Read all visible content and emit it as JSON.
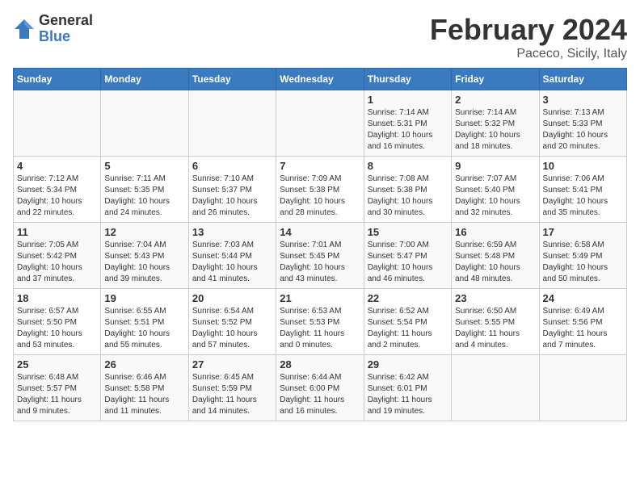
{
  "logo": {
    "general": "General",
    "blue": "Blue"
  },
  "title": "February 2024",
  "subtitle": "Paceco, Sicily, Italy",
  "days_of_week": [
    "Sunday",
    "Monday",
    "Tuesday",
    "Wednesday",
    "Thursday",
    "Friday",
    "Saturday"
  ],
  "weeks": [
    [
      {
        "day": "",
        "info": ""
      },
      {
        "day": "",
        "info": ""
      },
      {
        "day": "",
        "info": ""
      },
      {
        "day": "",
        "info": ""
      },
      {
        "day": "1",
        "info": "Sunrise: 7:14 AM\nSunset: 5:31 PM\nDaylight: 10 hours\nand 16 minutes."
      },
      {
        "day": "2",
        "info": "Sunrise: 7:14 AM\nSunset: 5:32 PM\nDaylight: 10 hours\nand 18 minutes."
      },
      {
        "day": "3",
        "info": "Sunrise: 7:13 AM\nSunset: 5:33 PM\nDaylight: 10 hours\nand 20 minutes."
      }
    ],
    [
      {
        "day": "4",
        "info": "Sunrise: 7:12 AM\nSunset: 5:34 PM\nDaylight: 10 hours\nand 22 minutes."
      },
      {
        "day": "5",
        "info": "Sunrise: 7:11 AM\nSunset: 5:35 PM\nDaylight: 10 hours\nand 24 minutes."
      },
      {
        "day": "6",
        "info": "Sunrise: 7:10 AM\nSunset: 5:37 PM\nDaylight: 10 hours\nand 26 minutes."
      },
      {
        "day": "7",
        "info": "Sunrise: 7:09 AM\nSunset: 5:38 PM\nDaylight: 10 hours\nand 28 minutes."
      },
      {
        "day": "8",
        "info": "Sunrise: 7:08 AM\nSunset: 5:38 PM\nDaylight: 10 hours\nand 30 minutes."
      },
      {
        "day": "9",
        "info": "Sunrise: 7:07 AM\nSunset: 5:40 PM\nDaylight: 10 hours\nand 32 minutes."
      },
      {
        "day": "10",
        "info": "Sunrise: 7:06 AM\nSunset: 5:41 PM\nDaylight: 10 hours\nand 35 minutes."
      }
    ],
    [
      {
        "day": "11",
        "info": "Sunrise: 7:05 AM\nSunset: 5:42 PM\nDaylight: 10 hours\nand 37 minutes."
      },
      {
        "day": "12",
        "info": "Sunrise: 7:04 AM\nSunset: 5:43 PM\nDaylight: 10 hours\nand 39 minutes."
      },
      {
        "day": "13",
        "info": "Sunrise: 7:03 AM\nSunset: 5:44 PM\nDaylight: 10 hours\nand 41 minutes."
      },
      {
        "day": "14",
        "info": "Sunrise: 7:01 AM\nSunset: 5:45 PM\nDaylight: 10 hours\nand 43 minutes."
      },
      {
        "day": "15",
        "info": "Sunrise: 7:00 AM\nSunset: 5:47 PM\nDaylight: 10 hours\nand 46 minutes."
      },
      {
        "day": "16",
        "info": "Sunrise: 6:59 AM\nSunset: 5:48 PM\nDaylight: 10 hours\nand 48 minutes."
      },
      {
        "day": "17",
        "info": "Sunrise: 6:58 AM\nSunset: 5:49 PM\nDaylight: 10 hours\nand 50 minutes."
      }
    ],
    [
      {
        "day": "18",
        "info": "Sunrise: 6:57 AM\nSunset: 5:50 PM\nDaylight: 10 hours\nand 53 minutes."
      },
      {
        "day": "19",
        "info": "Sunrise: 6:55 AM\nSunset: 5:51 PM\nDaylight: 10 hours\nand 55 minutes."
      },
      {
        "day": "20",
        "info": "Sunrise: 6:54 AM\nSunset: 5:52 PM\nDaylight: 10 hours\nand 57 minutes."
      },
      {
        "day": "21",
        "info": "Sunrise: 6:53 AM\nSunset: 5:53 PM\nDaylight: 11 hours\nand 0 minutes."
      },
      {
        "day": "22",
        "info": "Sunrise: 6:52 AM\nSunset: 5:54 PM\nDaylight: 11 hours\nand 2 minutes."
      },
      {
        "day": "23",
        "info": "Sunrise: 6:50 AM\nSunset: 5:55 PM\nDaylight: 11 hours\nand 4 minutes."
      },
      {
        "day": "24",
        "info": "Sunrise: 6:49 AM\nSunset: 5:56 PM\nDaylight: 11 hours\nand 7 minutes."
      }
    ],
    [
      {
        "day": "25",
        "info": "Sunrise: 6:48 AM\nSunset: 5:57 PM\nDaylight: 11 hours\nand 9 minutes."
      },
      {
        "day": "26",
        "info": "Sunrise: 6:46 AM\nSunset: 5:58 PM\nDaylight: 11 hours\nand 11 minutes."
      },
      {
        "day": "27",
        "info": "Sunrise: 6:45 AM\nSunset: 5:59 PM\nDaylight: 11 hours\nand 14 minutes."
      },
      {
        "day": "28",
        "info": "Sunrise: 6:44 AM\nSunset: 6:00 PM\nDaylight: 11 hours\nand 16 minutes."
      },
      {
        "day": "29",
        "info": "Sunrise: 6:42 AM\nSunset: 6:01 PM\nDaylight: 11 hours\nand 19 minutes."
      },
      {
        "day": "",
        "info": ""
      },
      {
        "day": "",
        "info": ""
      }
    ]
  ]
}
